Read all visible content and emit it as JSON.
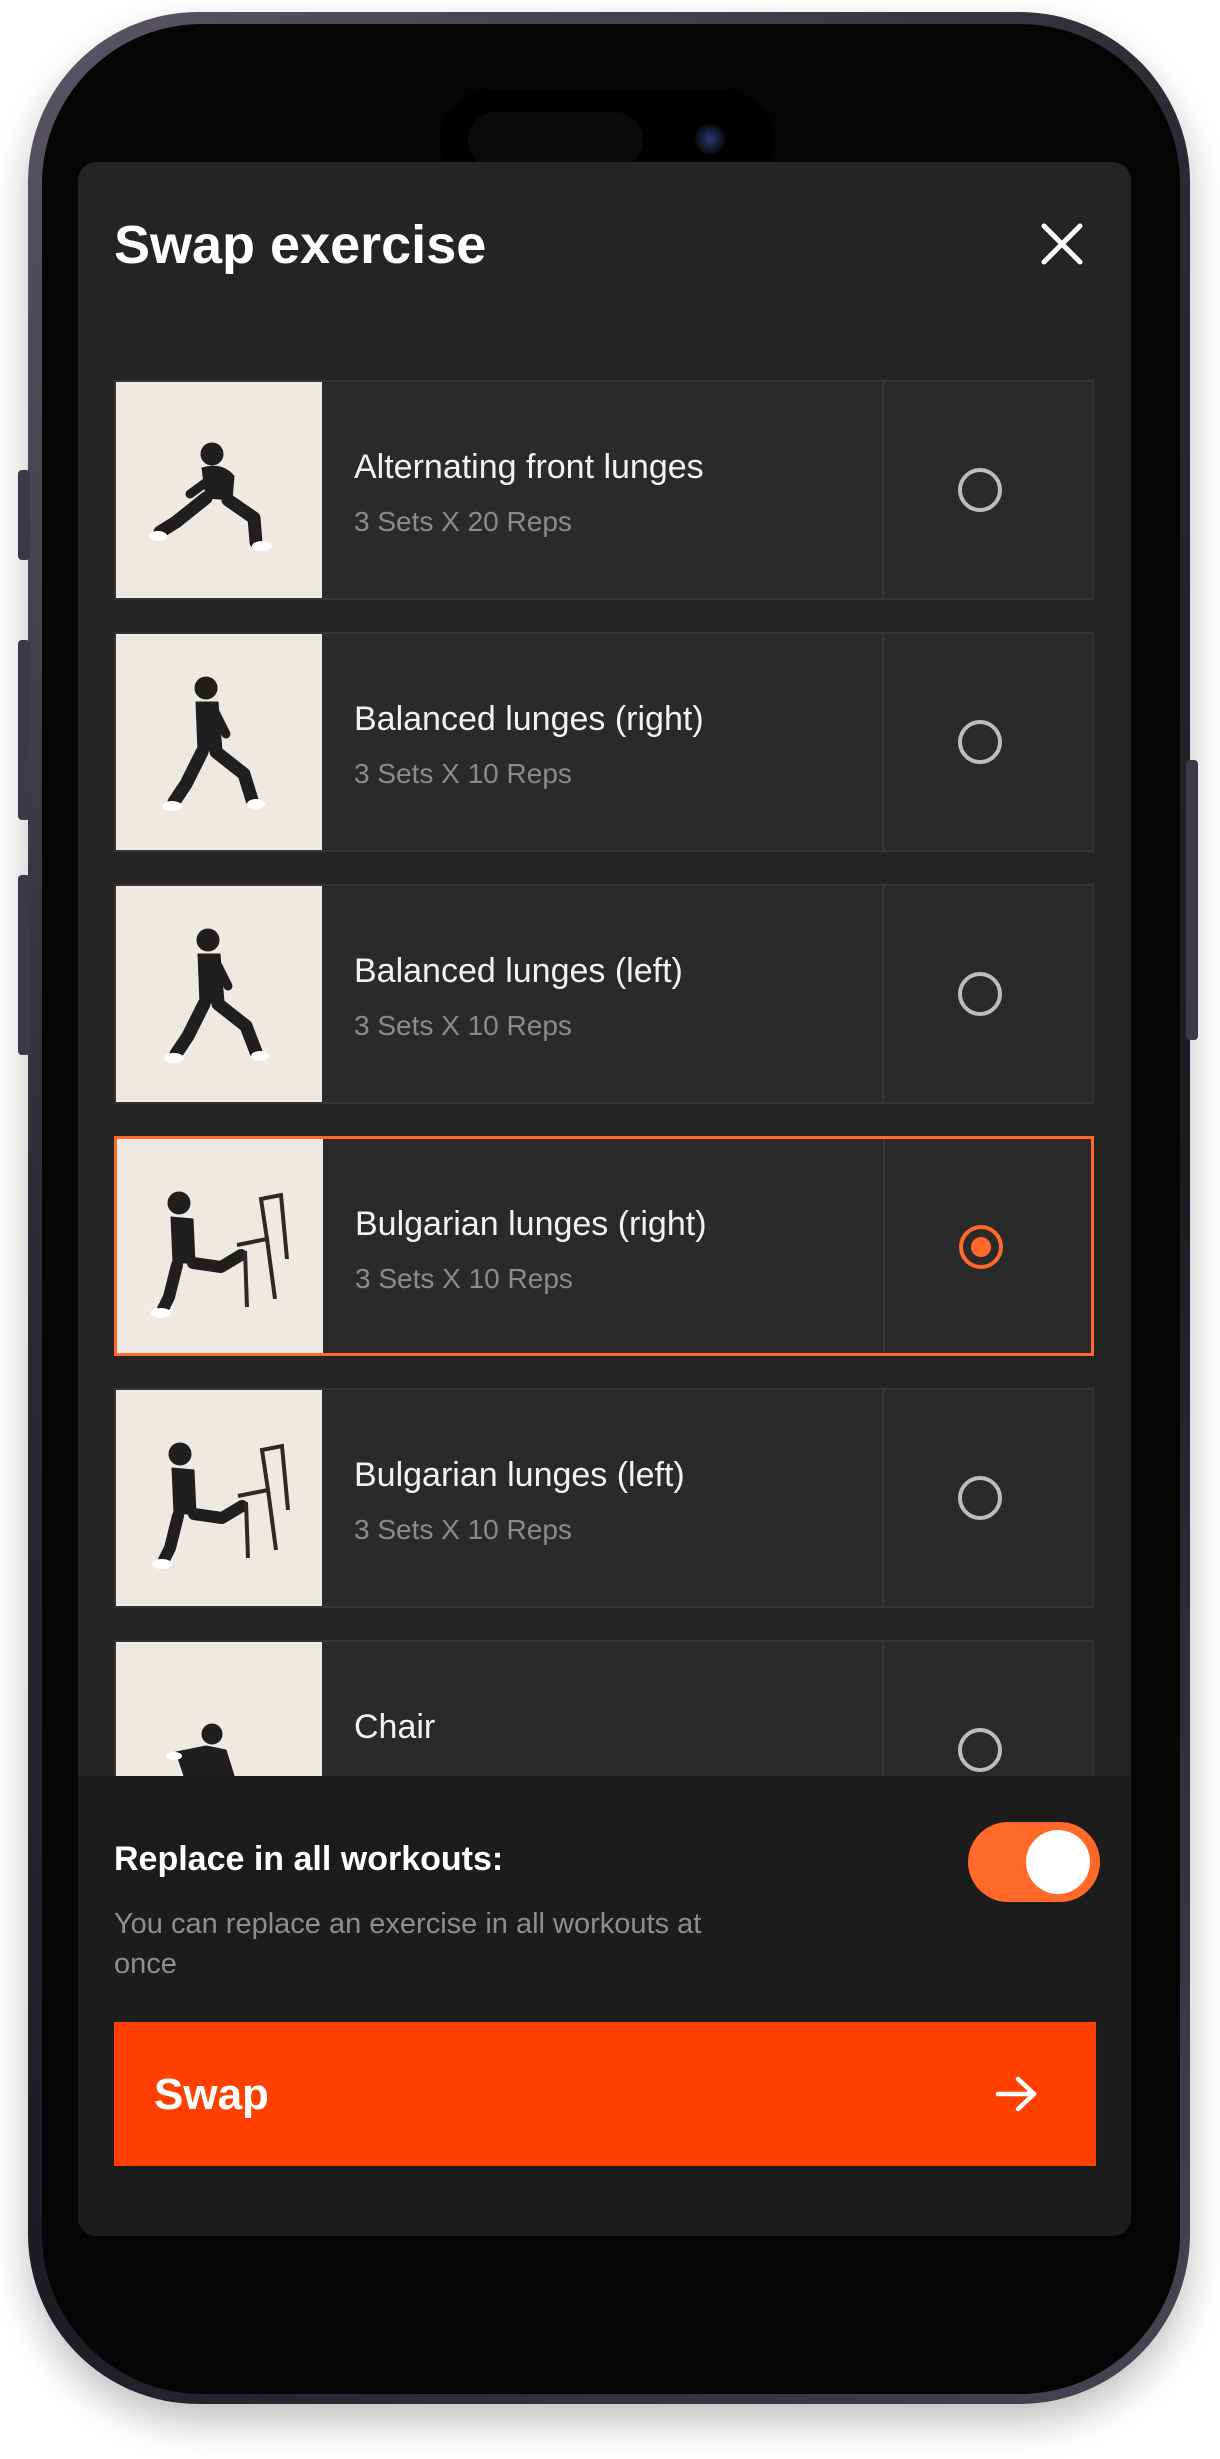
{
  "modal": {
    "title": "Swap exercise",
    "close_icon": "close-icon"
  },
  "exercises": [
    {
      "name": "Alternating front lunges",
      "meta": "3 Sets X 20 Reps",
      "selected": false
    },
    {
      "name": "Balanced lunges (right)",
      "meta": "3 Sets X 10 Reps",
      "selected": false
    },
    {
      "name": "Balanced lunges (left)",
      "meta": "3 Sets X 10 Reps",
      "selected": false
    },
    {
      "name": "Bulgarian lunges (right)",
      "meta": "3 Sets X 10 Reps",
      "selected": true
    },
    {
      "name": "Bulgarian lunges (left)",
      "meta": "3 Sets X 10 Reps",
      "selected": false
    },
    {
      "name": "Chair",
      "meta": "",
      "selected": false
    }
  ],
  "replace": {
    "title": "Replace in all workouts:",
    "description": "You can replace an exercise in all workouts at once",
    "enabled": true
  },
  "swap_button": {
    "label": "Swap",
    "icon": "arrow-right-icon"
  },
  "colors": {
    "accent": "#ff6a2b",
    "button": "#ff4000",
    "background": "#242424"
  }
}
